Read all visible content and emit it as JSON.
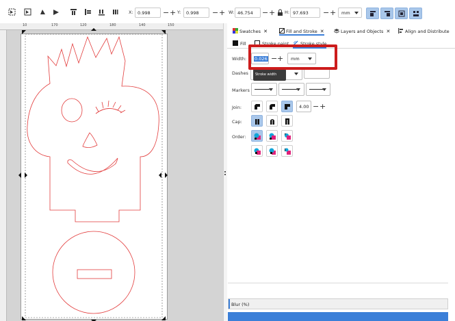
{
  "toolbar": {
    "x_label": "X:",
    "x_value": "0.998",
    "y_label": "Y:",
    "y_value": "0.998",
    "w_label": "W:",
    "w_value": "46.754",
    "h_label": "H:",
    "h_value": "97.693",
    "minus": "−",
    "plus": "+",
    "unit": "mm"
  },
  "ruler": {
    "ticks": [
      "10",
      "170",
      "120",
      "180",
      "140",
      "150"
    ]
  },
  "dock": {
    "tabs": [
      "Swatches",
      "Fill and Stroke",
      "Layers and Objects",
      "Align and Distribute"
    ],
    "close": "✕"
  },
  "subtabs": {
    "fill": "Fill",
    "stroke_paint": "Stroke paint",
    "stroke_style": "Stroke style"
  },
  "stroke_style": {
    "width_label": "Width:",
    "width_value": "0.026",
    "width_unit": "mm",
    "minus": "−",
    "plus": "+",
    "dashes_label": "Dashes",
    "markers_label": "Markers",
    "join_label": "Join:",
    "miter_value": "4.00",
    "cap_label": "Cap:",
    "order_label": "Order:",
    "tooltip": "Stroke width"
  },
  "bottom": {
    "blur_label": "Blur (%)"
  },
  "colors": {
    "accent": "#3b7fd8",
    "highlight": "#cc1c1c",
    "drawing": "#e23a3a",
    "order_cyan": "#12a5d8",
    "order_magenta": "#e0217a"
  }
}
